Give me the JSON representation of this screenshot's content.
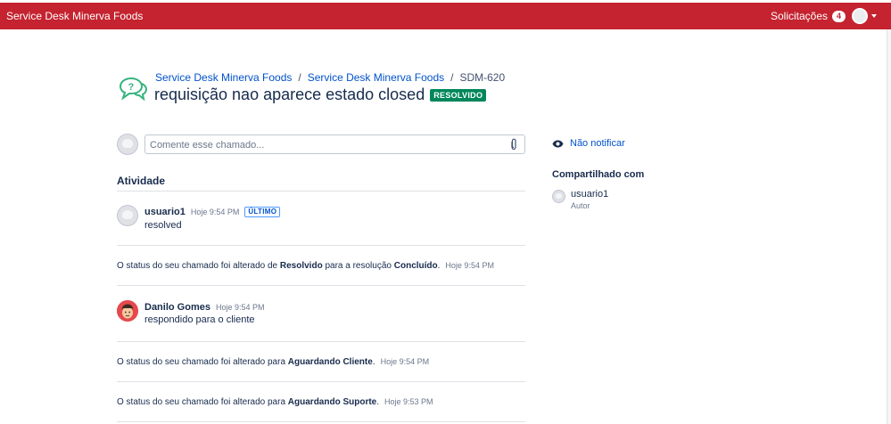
{
  "topbar": {
    "brand": "Service Desk Minerva Foods",
    "requests_label": "Solicitações",
    "requests_count": "4"
  },
  "breadcrumb": {
    "item1": "Service Desk Minerva Foods",
    "item2": "Service Desk Minerva Foods",
    "separator": "/",
    "key": "SDM-620"
  },
  "request": {
    "title": "requisição nao aparece estado closed",
    "status": "RESOLVIDO",
    "status_color": "#00875a"
  },
  "comment": {
    "placeholder": "Comente esse chamado..."
  },
  "activity": {
    "heading": "Atividade",
    "entry1": {
      "name": "usuario1",
      "time": "Hoje 9:54 PM",
      "tag": "ÚLTIMO",
      "body": "resolved"
    },
    "status1": {
      "prefix": "O status do seu chamado foi alterado de ",
      "from": "Resolvido",
      "mid": " para a resolução ",
      "to": "Concluído",
      "suffix": ".",
      "time": "Hoje 9:54 PM"
    },
    "entry2": {
      "name": "Danilo Gomes",
      "time": "Hoje 9:54 PM",
      "body": "respondido para o cliente"
    },
    "status2": {
      "prefix": "O status do seu chamado foi alterado para ",
      "to": "Aguardando Cliente",
      "suffix": ".",
      "time": "Hoje 9:54 PM"
    },
    "status3": {
      "prefix": "O status do seu chamado foi alterado para ",
      "to": "Aguardando Suporte",
      "suffix": ".",
      "time": "Hoje 9:53 PM"
    }
  },
  "sidebar": {
    "notify_label": "Não notificar",
    "shared_heading": "Compartilhado com",
    "shared_user": {
      "name": "usuario1",
      "role": "Autor"
    }
  },
  "colors": {
    "topbar": "#c4232f",
    "link": "#0052cc",
    "resolved": "#00875a"
  }
}
